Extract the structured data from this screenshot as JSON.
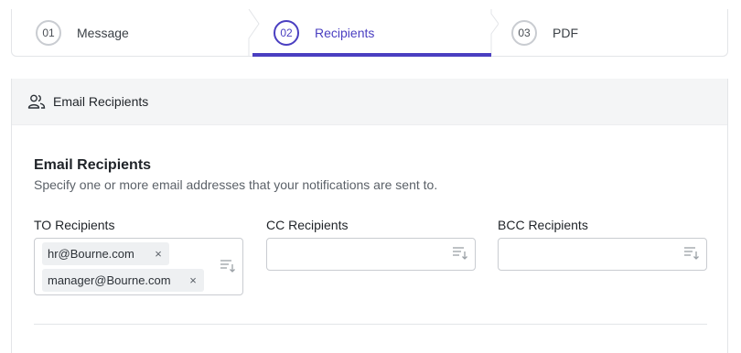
{
  "stepper": {
    "steps": [
      {
        "number": "01",
        "label": "Message",
        "active": false
      },
      {
        "number": "02",
        "label": "Recipients",
        "active": true
      },
      {
        "number": "03",
        "label": "PDF",
        "active": false
      }
    ],
    "accent": "#4a3fc1"
  },
  "section": {
    "header_title": "Email Recipients",
    "icon": "users-icon",
    "group_title": "Email Recipients",
    "group_description": "Specify one or more email addresses that your notifications are sent to."
  },
  "fields": {
    "to": {
      "label": "TO Recipients",
      "tags": [
        "hr@Bourne.com",
        "manager@Bourne.com"
      ]
    },
    "cc": {
      "label": "CC Recipients",
      "tags": []
    },
    "bcc": {
      "label": "BCC Recipients",
      "tags": []
    }
  },
  "icons": {
    "tag_remove": "×",
    "sort": "sort-list-icon"
  }
}
